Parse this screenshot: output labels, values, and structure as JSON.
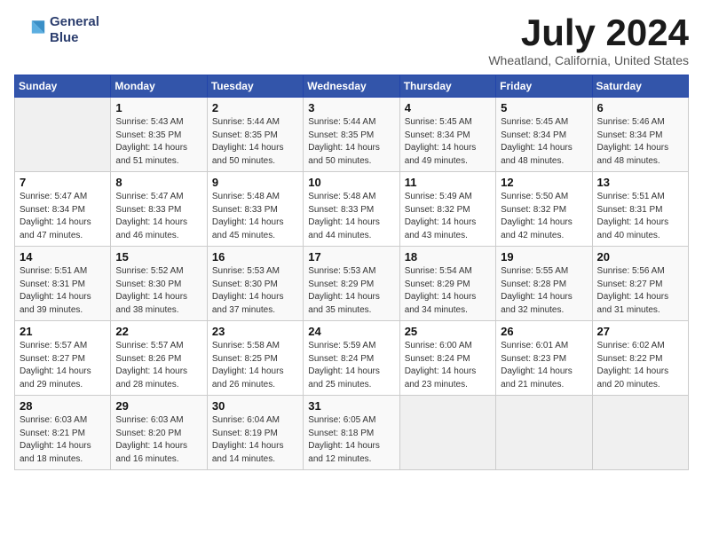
{
  "header": {
    "logo_line1": "General",
    "logo_line2": "Blue",
    "month_title": "July 2024",
    "location": "Wheatland, California, United States"
  },
  "days_of_week": [
    "Sunday",
    "Monday",
    "Tuesday",
    "Wednesday",
    "Thursday",
    "Friday",
    "Saturday"
  ],
  "weeks": [
    [
      {
        "num": "",
        "empty": true
      },
      {
        "num": "1",
        "sunrise": "5:43 AM",
        "sunset": "8:35 PM",
        "daylight": "14 hours and 51 minutes."
      },
      {
        "num": "2",
        "sunrise": "5:44 AM",
        "sunset": "8:35 PM",
        "daylight": "14 hours and 50 minutes."
      },
      {
        "num": "3",
        "sunrise": "5:44 AM",
        "sunset": "8:35 PM",
        "daylight": "14 hours and 50 minutes."
      },
      {
        "num": "4",
        "sunrise": "5:45 AM",
        "sunset": "8:34 PM",
        "daylight": "14 hours and 49 minutes."
      },
      {
        "num": "5",
        "sunrise": "5:45 AM",
        "sunset": "8:34 PM",
        "daylight": "14 hours and 48 minutes."
      },
      {
        "num": "6",
        "sunrise": "5:46 AM",
        "sunset": "8:34 PM",
        "daylight": "14 hours and 48 minutes."
      }
    ],
    [
      {
        "num": "7",
        "sunrise": "5:47 AM",
        "sunset": "8:34 PM",
        "daylight": "14 hours and 47 minutes."
      },
      {
        "num": "8",
        "sunrise": "5:47 AM",
        "sunset": "8:33 PM",
        "daylight": "14 hours and 46 minutes."
      },
      {
        "num": "9",
        "sunrise": "5:48 AM",
        "sunset": "8:33 PM",
        "daylight": "14 hours and 45 minutes."
      },
      {
        "num": "10",
        "sunrise": "5:48 AM",
        "sunset": "8:33 PM",
        "daylight": "14 hours and 44 minutes."
      },
      {
        "num": "11",
        "sunrise": "5:49 AM",
        "sunset": "8:32 PM",
        "daylight": "14 hours and 43 minutes."
      },
      {
        "num": "12",
        "sunrise": "5:50 AM",
        "sunset": "8:32 PM",
        "daylight": "14 hours and 42 minutes."
      },
      {
        "num": "13",
        "sunrise": "5:51 AM",
        "sunset": "8:31 PM",
        "daylight": "14 hours and 40 minutes."
      }
    ],
    [
      {
        "num": "14",
        "sunrise": "5:51 AM",
        "sunset": "8:31 PM",
        "daylight": "14 hours and 39 minutes."
      },
      {
        "num": "15",
        "sunrise": "5:52 AM",
        "sunset": "8:30 PM",
        "daylight": "14 hours and 38 minutes."
      },
      {
        "num": "16",
        "sunrise": "5:53 AM",
        "sunset": "8:30 PM",
        "daylight": "14 hours and 37 minutes."
      },
      {
        "num": "17",
        "sunrise": "5:53 AM",
        "sunset": "8:29 PM",
        "daylight": "14 hours and 35 minutes."
      },
      {
        "num": "18",
        "sunrise": "5:54 AM",
        "sunset": "8:29 PM",
        "daylight": "14 hours and 34 minutes."
      },
      {
        "num": "19",
        "sunrise": "5:55 AM",
        "sunset": "8:28 PM",
        "daylight": "14 hours and 32 minutes."
      },
      {
        "num": "20",
        "sunrise": "5:56 AM",
        "sunset": "8:27 PM",
        "daylight": "14 hours and 31 minutes."
      }
    ],
    [
      {
        "num": "21",
        "sunrise": "5:57 AM",
        "sunset": "8:27 PM",
        "daylight": "14 hours and 29 minutes."
      },
      {
        "num": "22",
        "sunrise": "5:57 AM",
        "sunset": "8:26 PM",
        "daylight": "14 hours and 28 minutes."
      },
      {
        "num": "23",
        "sunrise": "5:58 AM",
        "sunset": "8:25 PM",
        "daylight": "14 hours and 26 minutes."
      },
      {
        "num": "24",
        "sunrise": "5:59 AM",
        "sunset": "8:24 PM",
        "daylight": "14 hours and 25 minutes."
      },
      {
        "num": "25",
        "sunrise": "6:00 AM",
        "sunset": "8:24 PM",
        "daylight": "14 hours and 23 minutes."
      },
      {
        "num": "26",
        "sunrise": "6:01 AM",
        "sunset": "8:23 PM",
        "daylight": "14 hours and 21 minutes."
      },
      {
        "num": "27",
        "sunrise": "6:02 AM",
        "sunset": "8:22 PM",
        "daylight": "14 hours and 20 minutes."
      }
    ],
    [
      {
        "num": "28",
        "sunrise": "6:03 AM",
        "sunset": "8:21 PM",
        "daylight": "14 hours and 18 minutes."
      },
      {
        "num": "29",
        "sunrise": "6:03 AM",
        "sunset": "8:20 PM",
        "daylight": "14 hours and 16 minutes."
      },
      {
        "num": "30",
        "sunrise": "6:04 AM",
        "sunset": "8:19 PM",
        "daylight": "14 hours and 14 minutes."
      },
      {
        "num": "31",
        "sunrise": "6:05 AM",
        "sunset": "8:18 PM",
        "daylight": "14 hours and 12 minutes."
      },
      {
        "num": "",
        "empty": true
      },
      {
        "num": "",
        "empty": true
      },
      {
        "num": "",
        "empty": true
      }
    ]
  ]
}
